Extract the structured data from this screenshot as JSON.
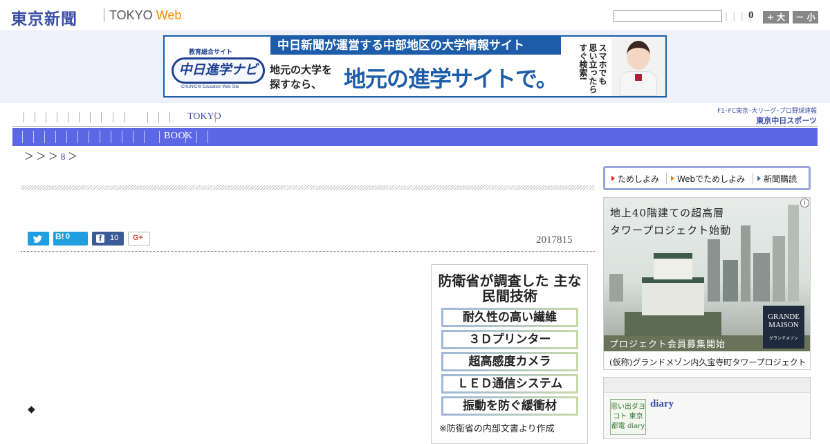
{
  "header": {
    "logo_jp": "東京新聞",
    "logo_tokyo": "TOKYO",
    "logo_web": "Web",
    "search_placeholder": "",
    "fontsize_bars": "| | | |",
    "fontsize_value": "0",
    "fontsize_large": "+ 大",
    "fontsize_small": "－ 小"
  },
  "banner": {
    "logo_tag": "教育総合サイト",
    "logo_main": "中日進学ナビ",
    "logo_sub": "CHUNICHI Education Web Site",
    "headline": "中日新聞が運営する中部地区の大学情報サイト",
    "small_text": "地元の大学を 探すなら、",
    "big_text": "地元の進学サイトで。",
    "vertical_text": "スマホでも 思い立ったら すぐ検索!"
  },
  "nav": {
    "tokyo_label": "TOKYO",
    "sports_link": "F1･FC東京･大リーグ･プロ野球速報",
    "sports_logo": "東京中日スポーツ",
    "book_label": "BOOK"
  },
  "breadcrumb": {
    "prefix": "＞ ＞ ＞",
    "link": "8",
    "suffix": "＞"
  },
  "article": {
    "share": {
      "hatena_label": "B!",
      "hatena_count": "0",
      "facebook_count": "10",
      "google_label": "G+"
    },
    "date": "2017815",
    "bullet": "◆"
  },
  "figure": {
    "title": "防衛省が調査した 主な民間技術",
    "items": [
      "耐久性の高い繊維",
      "３Ｄプリンター",
      "超高感度カメラ",
      "ＬＥＤ通信システム",
      "振動を防ぐ緩衝材"
    ],
    "note": "※防衛省の内部文書より作成"
  },
  "sidebar": {
    "subscribe": {
      "link1": "ためしよみ",
      "link2": "Webでためしよみ",
      "link3": "新聞購読"
    },
    "ad": {
      "text1": "地上40階建ての超高層",
      "text2": "タワープロジェクト始動",
      "bottom_text": "プロジェクト会員募集開始",
      "logo_main": "GRANDE MAISON",
      "logo_sub": "グランドメゾン",
      "caption": "(仮称)グランドメゾン内久宝寺町タワープロジェクト",
      "info_icon": "i"
    },
    "diary": {
      "thumb_text": "思い出ダヨコト 東京都電 diary",
      "title": "diary"
    }
  },
  "colors": {
    "brand_blue": "#3a4ea8",
    "category_bar": "#5c67e6",
    "web_orange": "#f08c00",
    "banner_blue": "#1c5ca8"
  }
}
